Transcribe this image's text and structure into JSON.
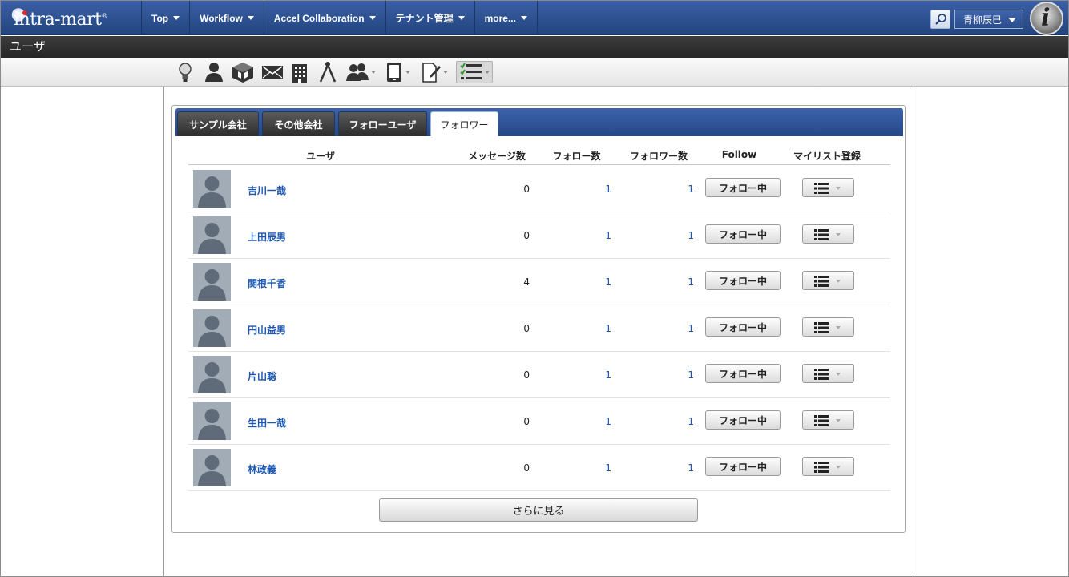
{
  "app": {
    "logo_text": "intra-mart",
    "logo_reg": "®"
  },
  "nav": {
    "menu": [
      {
        "label": "Top"
      },
      {
        "label": "Workflow"
      },
      {
        "label": "Accel Collaboration"
      },
      {
        "label": "テナント管理"
      },
      {
        "label": "more..."
      }
    ],
    "user_name": "青柳辰巳",
    "badge_letter": "i"
  },
  "page": {
    "title": "ユーザ"
  },
  "toolbar": {
    "icons": [
      "lightbulb-icon",
      "person-icon",
      "cube-icon",
      "mail-icon",
      "building-icon",
      "compass-icon",
      "group-icon",
      "phone-icon",
      "edit-icon",
      "checklist-icon"
    ]
  },
  "tabs": [
    {
      "label": "サンプル会社"
    },
    {
      "label": "その他会社"
    },
    {
      "label": "フォローユーザ"
    },
    {
      "label": "フォロワー"
    }
  ],
  "table": {
    "headers": {
      "user": "ユーザ",
      "messages": "メッセージ数",
      "follows": "フォロー数",
      "followers": "フォロワー数",
      "follow": "Follow",
      "mylist": "マイリスト登録"
    },
    "rows": [
      {
        "name": "吉川一哉",
        "messages": "0",
        "follows": "1",
        "followers": "1",
        "follow_label": "フォロー中"
      },
      {
        "name": "上田辰男",
        "messages": "0",
        "follows": "1",
        "followers": "1",
        "follow_label": "フォロー中"
      },
      {
        "name": "関根千香",
        "messages": "4",
        "follows": "1",
        "followers": "1",
        "follow_label": "フォロー中"
      },
      {
        "name": "円山益男",
        "messages": "0",
        "follows": "1",
        "followers": "1",
        "follow_label": "フォロー中"
      },
      {
        "name": "片山聡",
        "messages": "0",
        "follows": "1",
        "followers": "1",
        "follow_label": "フォロー中"
      },
      {
        "name": "生田一哉",
        "messages": "0",
        "follows": "1",
        "followers": "1",
        "follow_label": "フォロー中"
      },
      {
        "name": "林政義",
        "messages": "0",
        "follows": "1",
        "followers": "1",
        "follow_label": "フォロー中"
      }
    ]
  },
  "more_button": "さらに見る",
  "colors": {
    "nav_blue": "#23457f",
    "link_blue": "#1b56b0",
    "title_dark": "#262626"
  }
}
